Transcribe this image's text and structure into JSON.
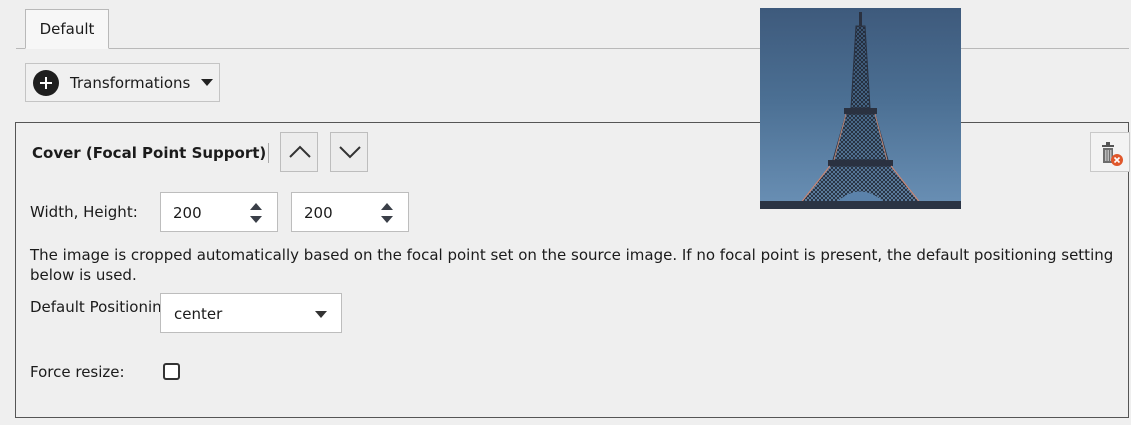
{
  "tabs": [
    {
      "label": "Default",
      "active": true
    }
  ],
  "toolbar": {
    "transformations_label": "Transformations"
  },
  "transformation": {
    "title": "Cover (Focal Point Support)",
    "width_height_label": "Width, Height:",
    "width_value": "200",
    "height_value": "200",
    "description": "The image is cropped automatically based on the focal point set on the source image. If no focal point is present, the default positioning setting below is used.",
    "default_positioning_label": "Default Positioning:",
    "default_positioning_value": "center",
    "force_resize_label": "Force resize:",
    "force_resize_checked": false
  },
  "icons": {
    "add": "plus-circle-icon",
    "dropdown": "caret-down-icon",
    "move_up": "chevron-up-icon",
    "move_down": "chevron-down-icon",
    "delete": "trash-delete-icon",
    "spinner": "spinner-arrows-icon"
  },
  "preview": {
    "subject": "Eiffel Tower thumbnail"
  },
  "colors": {
    "panel_border": "#555555",
    "background": "#efefef",
    "delete_badge": "#e0572b"
  }
}
